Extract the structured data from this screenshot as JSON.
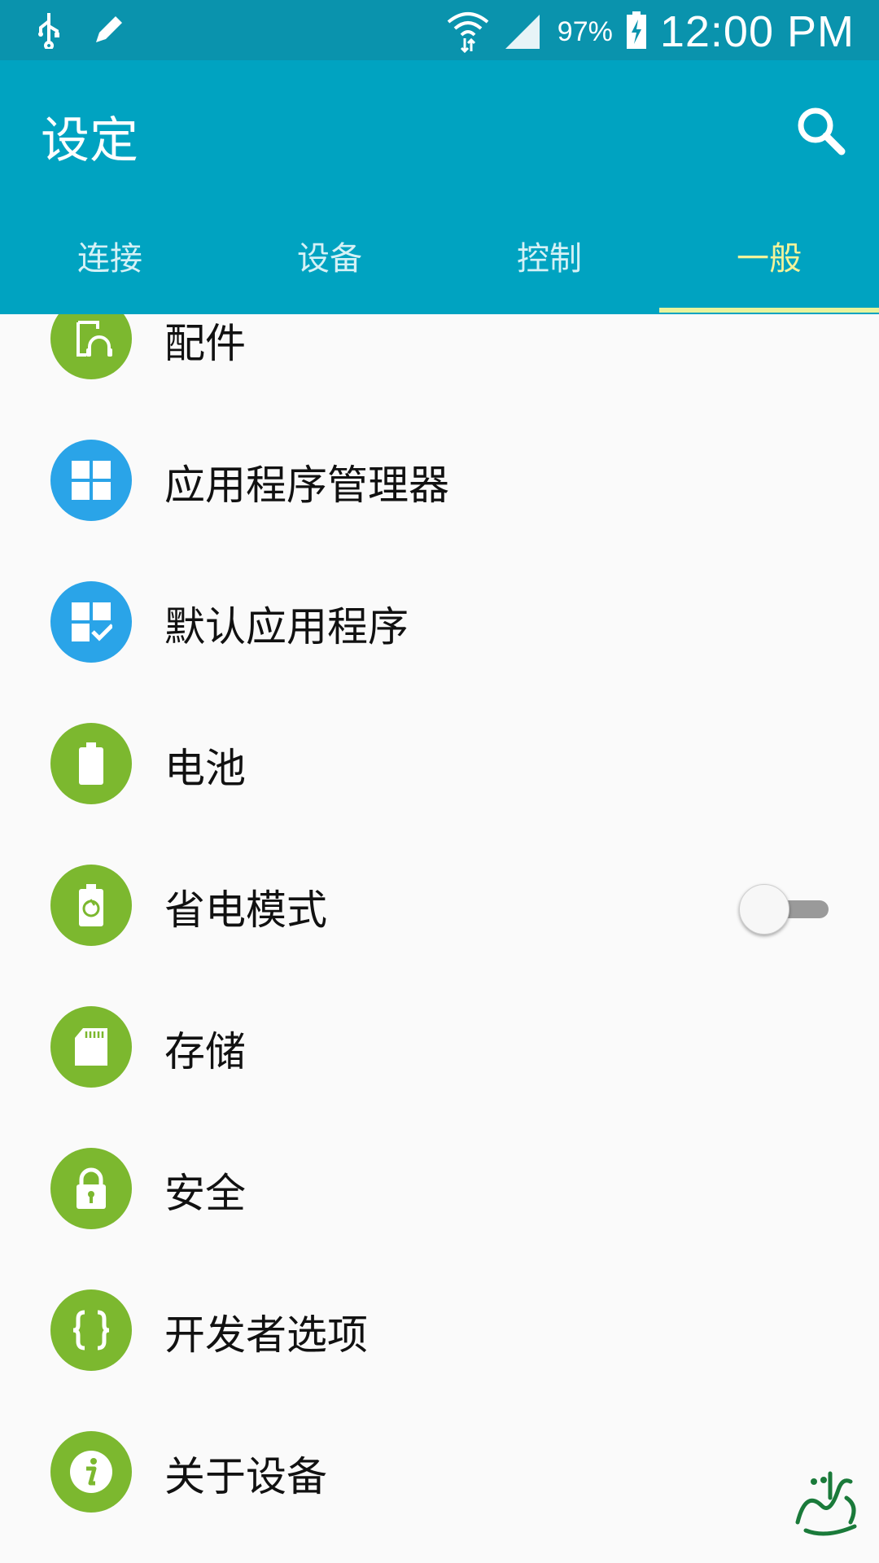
{
  "status_bar": {
    "battery_percent": "97%",
    "time": "12:00 PM",
    "icons": [
      "usb-icon",
      "edit-icon",
      "wifi-icon",
      "signal-icon",
      "battery-charging-icon"
    ]
  },
  "header": {
    "title": "设定",
    "search_icon": "search-icon"
  },
  "tabs": [
    {
      "label": "连接",
      "active": false
    },
    {
      "label": "设备",
      "active": false
    },
    {
      "label": "控制",
      "active": false
    },
    {
      "label": "一般",
      "active": true
    }
  ],
  "list": [
    {
      "label": "配件",
      "icon": "accessories-icon",
      "color": "#7cb82f"
    },
    {
      "label": "应用程序管理器",
      "icon": "app-manager-icon",
      "color": "#2aa4e8"
    },
    {
      "label": "默认应用程序",
      "icon": "default-apps-icon",
      "color": "#2aa4e8"
    },
    {
      "label": "电池",
      "icon": "battery-icon",
      "color": "#7cb82f"
    },
    {
      "label": "省电模式",
      "icon": "power-saving-icon",
      "color": "#7cb82f",
      "toggle": false
    },
    {
      "label": "存储",
      "icon": "storage-icon",
      "color": "#7cb82f"
    },
    {
      "label": "安全",
      "icon": "lock-icon",
      "color": "#7cb82f"
    },
    {
      "label": "开发者选项",
      "icon": "developer-options-icon",
      "color": "#7cb82f"
    },
    {
      "label": "关于设备",
      "icon": "info-icon",
      "color": "#7cb82f"
    }
  ],
  "colors": {
    "status_bar": "#0a93ad",
    "app_bar": "#00a3c1",
    "active_tab": "#f3f39a",
    "green_icon": "#7cb82f",
    "blue_icon": "#2aa4e8"
  }
}
